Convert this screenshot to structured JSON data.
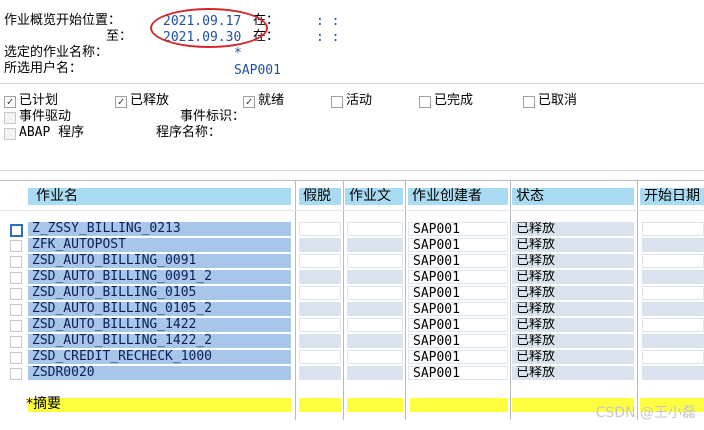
{
  "header": {
    "start_label": "作业概览开始位置：",
    "start_date": "2021.09.17",
    "at_label_1": "在：",
    "time_1": ":  :",
    "to_label": "至：",
    "end_date": "2021.09.30",
    "at_label_2": "在：",
    "time_2": ":  :",
    "job_name_label": "选定的作业名称：",
    "job_name_value": "*",
    "user_label": "所选用户名：",
    "user_value": "SAP001"
  },
  "status_filters": [
    {
      "label": "已计划",
      "checked": true
    },
    {
      "label": "已释放",
      "checked": true
    },
    {
      "label": "就绪",
      "checked": true
    },
    {
      "label": "活动",
      "checked": false
    },
    {
      "label": "已完成",
      "checked": false
    },
    {
      "label": "已取消",
      "checked": false
    }
  ],
  "extra_filters": {
    "event_driven": "事件驱动",
    "event_id_label": "事件标识：",
    "abap_program": "ABAP 程序",
    "program_name_label": "程序名称："
  },
  "table": {
    "columns": [
      "作业名",
      "假脱",
      "作业文",
      "作业创建者",
      "状态",
      "开始日期"
    ],
    "rows": [
      {
        "name": "Z_ZSSY_BILLING_0213",
        "creator": "SAP001",
        "status": "已释放",
        "selected": true
      },
      {
        "name": "ZFK_AUTOPOST",
        "creator": "SAP001",
        "status": "已释放",
        "selected": false
      },
      {
        "name": "ZSD_AUTO_BILLING_0091",
        "creator": "SAP001",
        "status": "已释放",
        "selected": false
      },
      {
        "name": "ZSD_AUTO_BILLING_0091_2",
        "creator": "SAP001",
        "status": "已释放",
        "selected": false
      },
      {
        "name": "ZSD_AUTO_BILLING_0105",
        "creator": "SAP001",
        "status": "已释放",
        "selected": false
      },
      {
        "name": "ZSD_AUTO_BILLING_0105_2",
        "creator": "SAP001",
        "status": "已释放",
        "selected": false
      },
      {
        "name": "ZSD_AUTO_BILLING_1422",
        "creator": "SAP001",
        "status": "已释放",
        "selected": false
      },
      {
        "name": "ZSD_AUTO_BILLING_1422_2",
        "creator": "SAP001",
        "status": "已释放",
        "selected": false
      },
      {
        "name": "ZSD_CREDIT_RECHECK_1000",
        "creator": "SAP001",
        "status": "已释放",
        "selected": false
      },
      {
        "name": "ZSDR0020",
        "creator": "SAP001",
        "status": "已释放",
        "selected": false
      }
    ],
    "summary": "*摘要"
  },
  "watermark": "CSDN @王小磊",
  "colors": {
    "highlight": "#d0282c",
    "header": "#a9dcf2",
    "row": "#a8c6ea",
    "summary": "#ffff40"
  }
}
